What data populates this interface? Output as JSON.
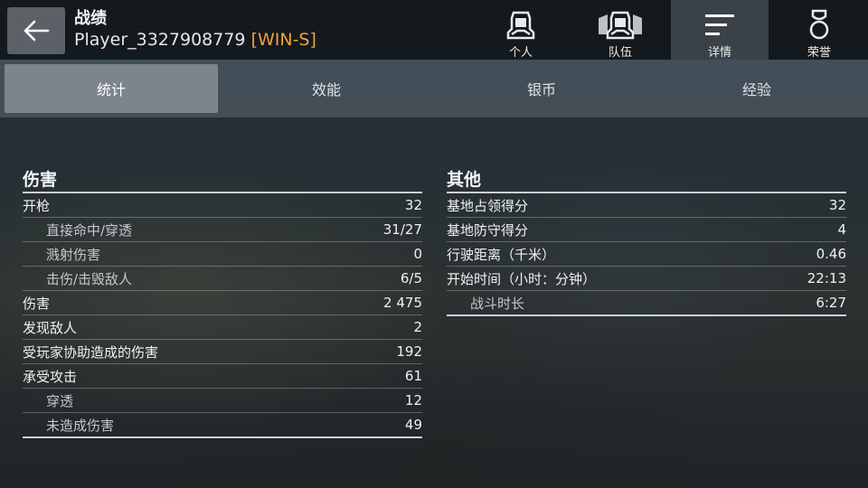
{
  "header": {
    "title": "战绩",
    "player_name": "Player_3327908779",
    "player_rank": "[WIN-S]"
  },
  "nav_tabs": [
    {
      "label": "个人",
      "icon": "helmet-icon"
    },
    {
      "label": "队伍",
      "icon": "team-helmets-icon"
    },
    {
      "label": "详情",
      "icon": "list-details-icon",
      "active": true
    },
    {
      "label": "荣誉",
      "icon": "medal-icon"
    }
  ],
  "sub_tabs": [
    {
      "label": "统计",
      "active": true
    },
    {
      "label": "效能"
    },
    {
      "label": "银币"
    },
    {
      "label": "经验"
    }
  ],
  "damage": {
    "title": "伤害",
    "rows": [
      {
        "label": "开枪",
        "value": "32",
        "sub": false
      },
      {
        "label": "直接命中/穿透",
        "value": "31/27",
        "sub": true
      },
      {
        "label": "溅射伤害",
        "value": "0",
        "sub": true
      },
      {
        "label": "击伤/击毁敌人",
        "value": "6/5",
        "sub": true
      },
      {
        "label": "伤害",
        "value": "2 475",
        "sub": false
      },
      {
        "label": "发现敌人",
        "value": "2",
        "sub": false
      },
      {
        "label": "受玩家协助造成的伤害",
        "value": "192",
        "sub": false
      },
      {
        "label": "承受攻击",
        "value": "61",
        "sub": false
      },
      {
        "label": "穿透",
        "value": "12",
        "sub": true
      },
      {
        "label": "未造成伤害",
        "value": "49",
        "sub": true
      }
    ]
  },
  "other": {
    "title": "其他",
    "rows": [
      {
        "label": "基地占领得分",
        "value": "32",
        "sub": false
      },
      {
        "label": "基地防守得分",
        "value": "4",
        "sub": false
      },
      {
        "label": "行驶距离（千米）",
        "value": "0.46",
        "sub": false
      },
      {
        "label": "开始时间（小时：分钟）",
        "value": "22:13",
        "sub": false
      },
      {
        "label": "战斗时长",
        "value": "6:27",
        "sub": true
      }
    ]
  },
  "colors": {
    "accent_rank": "#f0a23c",
    "active_tab": "#7d858c",
    "topbar": "#14191d"
  }
}
